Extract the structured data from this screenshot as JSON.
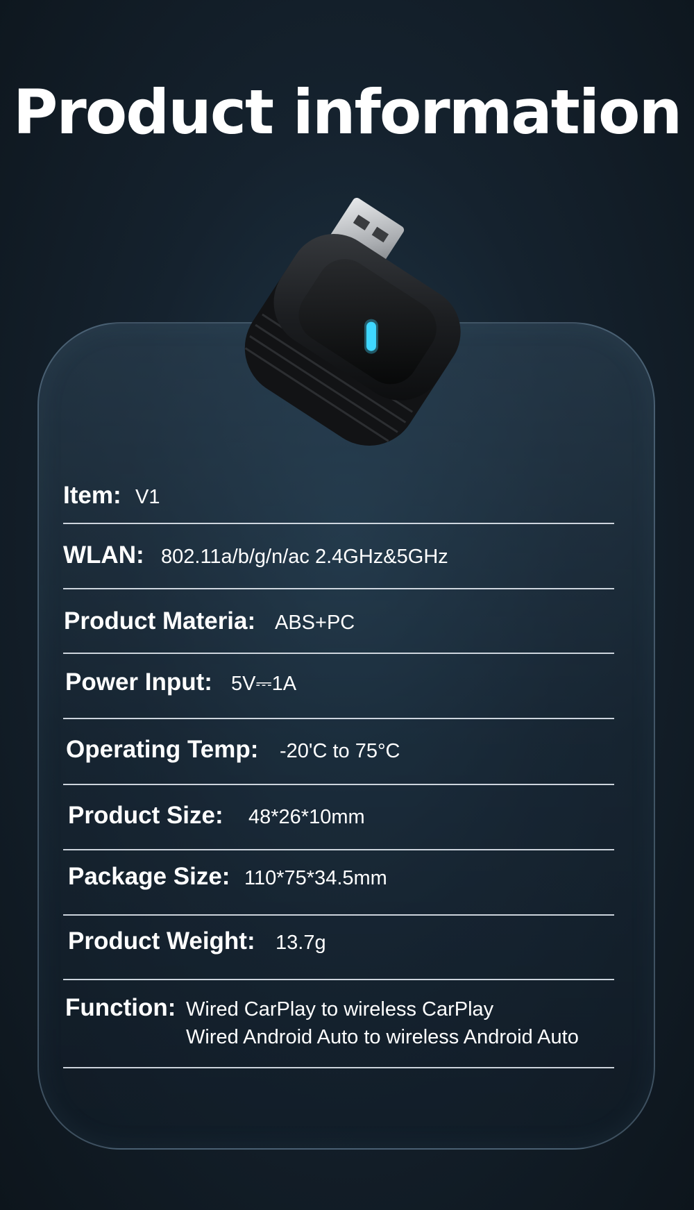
{
  "header": {
    "title": "Product information"
  },
  "product": {
    "image_icon": "usb-wireless-adapter-icon",
    "led_color": "#3fd8ff"
  },
  "specs": [
    {
      "label": "Item:",
      "value": "V1"
    },
    {
      "label": "WLAN:",
      "value": "802.11a/b/g/n/ac 2.4GHz&5GHz"
    },
    {
      "label": "Product Materia:",
      "value": "ABS+PC"
    },
    {
      "label": "Power Input:",
      "value": "5V⎓1A"
    },
    {
      "label": "Operating Temp:",
      "value": "-20'C to 75°C"
    },
    {
      "label": "Product Size:",
      "value": "48*26*10mm"
    },
    {
      "label": "Package Size:",
      "value": "110*75*34.5mm"
    },
    {
      "label": "Product Weight:",
      "value": "13.7g"
    },
    {
      "label": "Function:",
      "value": "Wired CarPlay to wireless CarPlay",
      "value2": "Wired Android Auto to wireless Android Auto"
    }
  ]
}
